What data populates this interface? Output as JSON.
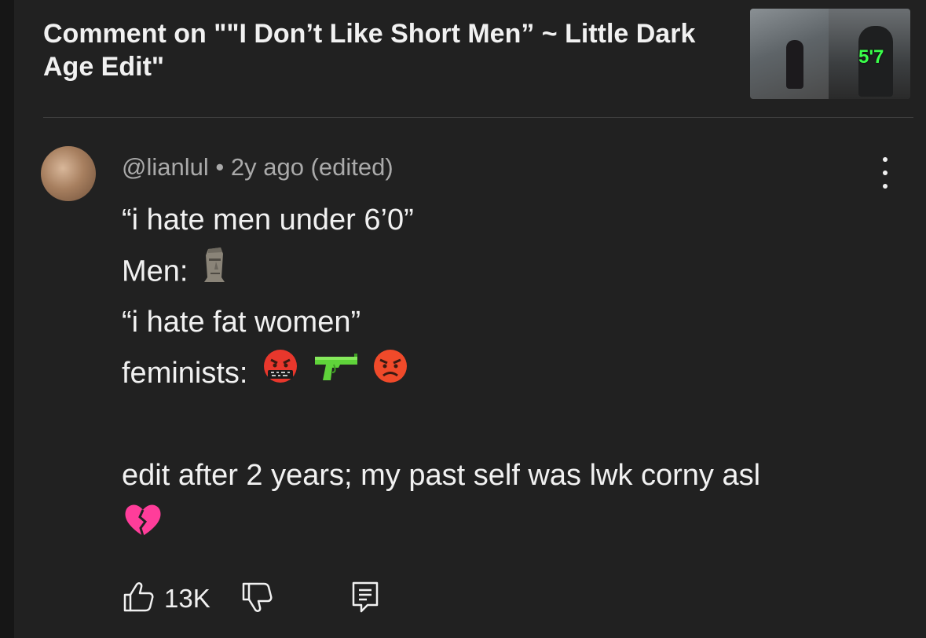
{
  "header": {
    "title": "Comment on \"\"I Don’t Like Short Men” ~ Little Dark Age Edit\"",
    "thumbnail_text": "5'7"
  },
  "comment": {
    "author": "@lianlul",
    "separator": "•",
    "age": "2y ago (edited)",
    "lines": [
      "“i hate men under 6’0”",
      "Men:",
      "“i hate fat women”",
      "feminists:",
      "",
      "edit after 2 years; my past self was lwk corny asl"
    ],
    "emojis": [
      "moai-icon",
      "cursing-face-icon",
      "water-pistol-icon",
      "angry-face-icon",
      "broken-heart-icon"
    ]
  },
  "actions": {
    "like_count": "13K",
    "icons": [
      "thumbs-up-icon",
      "thumbs-down-icon",
      "reply-icon"
    ]
  },
  "colors": {
    "background": "#212121",
    "text_primary": "#f1f1f1",
    "text_secondary": "#aaaaaa",
    "thumb_label": "#3aff4a"
  }
}
